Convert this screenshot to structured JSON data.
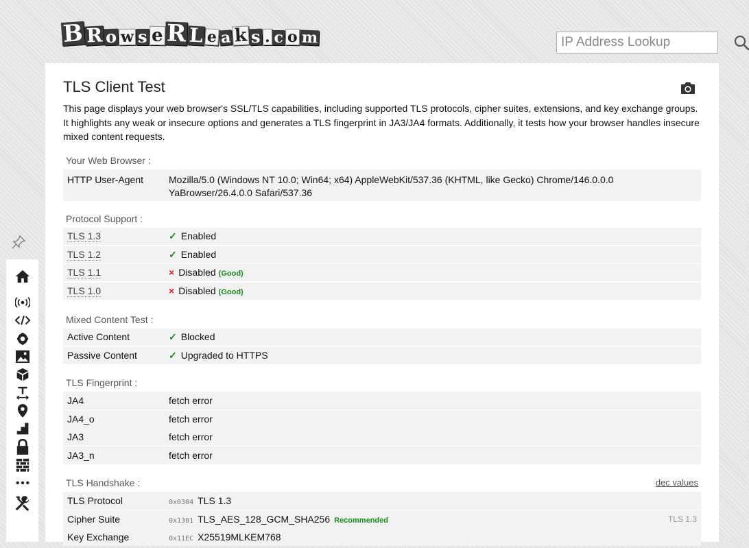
{
  "logo": {
    "parts": [
      {
        "t": "B",
        "size": 34,
        "w": false
      },
      {
        "t": "R",
        "size": 28,
        "w": false
      },
      {
        "t": "o",
        "size": 24,
        "w": false
      },
      {
        "t": "w",
        "size": 22,
        "w": true
      },
      {
        "t": "s",
        "size": 24,
        "w": false
      },
      {
        "t": "e",
        "size": 26,
        "w": true
      },
      {
        "t": "R",
        "size": 34,
        "w": false
      },
      {
        "t": "L",
        "size": 28,
        "w": false
      },
      {
        "t": "e",
        "size": 22,
        "w": true
      },
      {
        "t": "a",
        "size": 22,
        "w": false
      },
      {
        "t": "k",
        "size": 26,
        "w": true
      },
      {
        "t": "s",
        "size": 24,
        "w": false
      },
      {
        "t": ".",
        "size": 22,
        "w": true
      },
      {
        "t": "c",
        "size": 22,
        "w": false
      },
      {
        "t": "o",
        "size": 22,
        "w": true
      },
      {
        "t": "m",
        "size": 22,
        "w": false
      }
    ]
  },
  "search": {
    "placeholder": "IP Address Lookup"
  },
  "sidebar": {
    "icons": [
      "home-icon",
      "signal-icon",
      "code-icon",
      "flower-icon",
      "image-icon",
      "cube-icon",
      "text-size-icon",
      "location-pin-icon",
      "stairs-icon",
      "lock-icon",
      "wall-icon",
      "more-icon",
      "tools-icon"
    ]
  },
  "page": {
    "title": "TLS Client Test",
    "description": "This page displays your web browser's SSL/TLS capabilities, including supported TLS protocols, cipher suites, extensions, and key exchange groups. It highlights any weak or insecure options and generates a TLS fingerprint in JA3/JA4 formats. Additionally, it tests how your browser handles insecure mixed content requests."
  },
  "browser": {
    "heading": "Your Web Browser :",
    "ua_label": "HTTP User-Agent",
    "ua_value": "Mozilla/5.0 (Windows NT 10.0; Win64; x64) AppleWebKit/537.36 (KHTML, like Gecko) Chrome/146.0.0.0 YaBrowser/26.4.0.0 Safari/537.36"
  },
  "protocols": {
    "heading": "Protocol Support :",
    "rows": [
      {
        "name": "TLS 1.3",
        "mark": "✓",
        "status": "Enabled",
        "note": ""
      },
      {
        "name": "TLS 1.2",
        "mark": "✓",
        "status": "Enabled",
        "note": ""
      },
      {
        "name": "TLS 1.1",
        "mark": "×",
        "status": "Disabled",
        "note": "(Good)"
      },
      {
        "name": "TLS 1.0",
        "mark": "×",
        "status": "Disabled",
        "note": "(Good)"
      }
    ]
  },
  "mixed": {
    "heading": "Mixed Content Test :",
    "rows": [
      {
        "name": "Active Content",
        "mark": "✓",
        "status": "Blocked"
      },
      {
        "name": "Passive Content",
        "mark": "✓",
        "status": "Upgraded to HTTPS"
      }
    ]
  },
  "fingerprint": {
    "heading": "TLS Fingerprint :",
    "rows": [
      {
        "name": "JA4",
        "value": "fetch error"
      },
      {
        "name": "JA4_o",
        "value": "fetch error"
      },
      {
        "name": "JA3",
        "value": "fetch error"
      },
      {
        "name": "JA3_n",
        "value": "fetch error"
      }
    ]
  },
  "handshake": {
    "heading": "TLS Handshake :",
    "link": "dec values",
    "rows": [
      {
        "name": "TLS Protocol",
        "hex": "0x0304",
        "value": "TLS 1.3",
        "badge": "",
        "right": ""
      },
      {
        "name": "Cipher Suite",
        "hex": "0x1301",
        "value": "TLS_AES_128_GCM_SHA256",
        "badge": "Recommended",
        "right": "TLS 1.3"
      },
      {
        "name": "Key Exchange",
        "hex": "0x11EC",
        "value": "X25519MLKEM768",
        "badge": "",
        "right": ""
      }
    ]
  }
}
